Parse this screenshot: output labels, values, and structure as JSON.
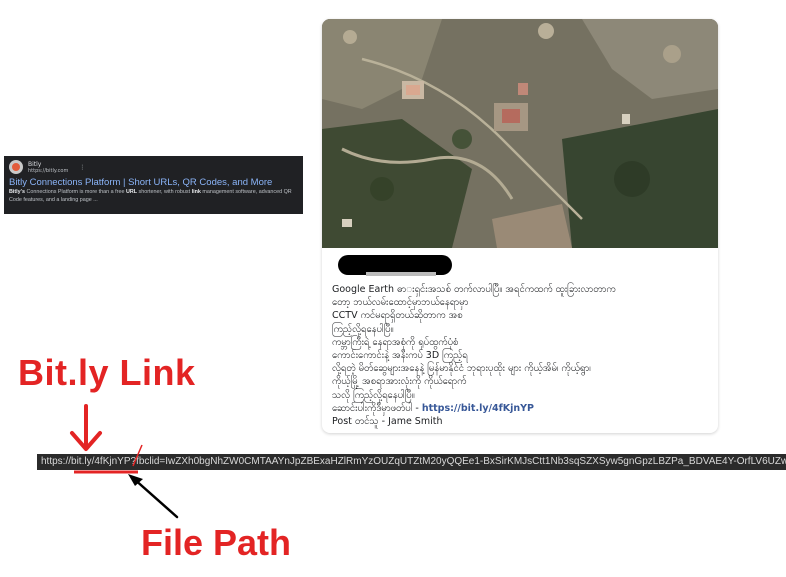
{
  "search_result": {
    "site_name": "Bitly",
    "site_url": "https://bitly.com",
    "menu_glyph": "⋮",
    "title": "Bitly Connections Platform | Short URLs, QR Codes, and More",
    "desc_bold1": "Bitly's",
    "desc_part1": " Connections Platform is more than a free ",
    "desc_bold2": "URL",
    "desc_part2": " shortener, with robust ",
    "desc_bold3": "link",
    "desc_part3": " management software, advanced QR Code features, and a landing page ..."
  },
  "post": {
    "lines": [
      "Google Earth ဓာ­းရှင်းအသစ် တက်လာပါပြီ။ အရင်ကထက် ထူးခြားလာတာက",
      "တော့ ဘယ်လမ်းထောင့်မှာဘယ်နေရာမှာ",
      "CCTV ကင်မရာရှိတယ်ဆိုတာက အစ",
      "ကြည့်လို့ရနေပါပြီ။",
      "ကမ္ဘာကြီးရဲ့ နေရာအစုံကို ရုပ်ထွက်ပုံစံ",
      "ကောင်းကောင်းနဲ့ အနီးကပ် 3D ကြည့်ရ",
      "လို့ရတဲ့ မိတ်ဆွေများအနေနဲ့ မြန်မာနိုင်ငံ ဘုရားပုထိုး များ ကိုယ့်အိမ်၊ ကိုယ့်ရွာ၊",
      "ကိုယ့်မြို့ အစရာအားလုံးကို ကိုယ်ရောက်",
      "သလို ကြည့်လို့ရနေပါပြီ။"
    ],
    "link_prefix": "ဆောင်းပါးကိုဒီမှာဖတ်ပါ - ",
    "link_text": "https://bit.ly/4fKjnYP",
    "author": "Post တင်သူ - Jame Smith"
  },
  "annotations": {
    "bitly_label": "Bit.ly Link",
    "filepath_label": "File Path",
    "color": "#e32424"
  },
  "url_bar": {
    "text": "https://bit.ly/4fKjnYP?fbclid=IwZXh0bgNhZW0CMTAAYnJpZBExaHZlRmYzOUZqUTZtM20yQQEe1-BxSirKMJsCtt1Nb3sqSZXSyw5gnGpzLBZPa_BDVAE4Y-OrfLV6UZwXv"
  }
}
